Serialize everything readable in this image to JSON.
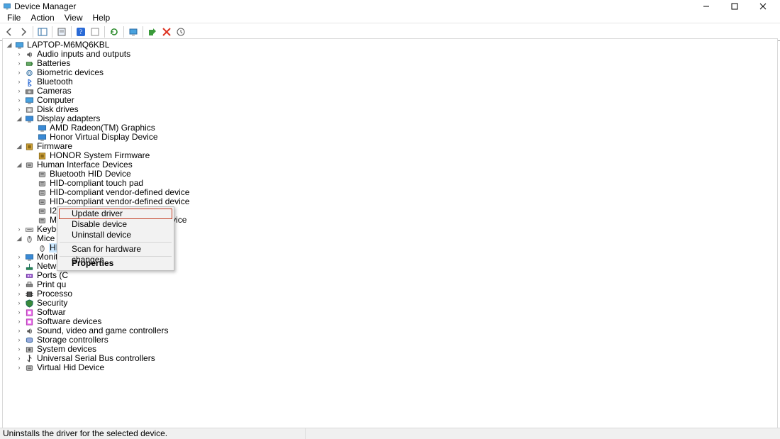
{
  "window": {
    "title": "Device Manager"
  },
  "menubar": [
    "File",
    "Action",
    "View",
    "Help"
  ],
  "statusbar": "Uninstalls the driver for the selected device.",
  "context_menu": {
    "items": [
      {
        "label": "Update driver",
        "highlighted": true
      },
      {
        "label": "Disable device"
      },
      {
        "label": "Uninstall device"
      },
      {
        "separator": true
      },
      {
        "label": "Scan for hardware changes"
      },
      {
        "separator": true
      },
      {
        "label": "Properties",
        "bold": true
      }
    ]
  },
  "tree": {
    "root": {
      "label": "LAPTOP-M6MQ6KBL",
      "icon": "computer-icon",
      "expanded": true
    },
    "categories": [
      {
        "label": "Audio inputs and outputs",
        "icon": "audio-icon",
        "state": "collapsed"
      },
      {
        "label": "Batteries",
        "icon": "battery-icon",
        "state": "collapsed"
      },
      {
        "label": "Biometric devices",
        "icon": "biometric-icon",
        "state": "collapsed"
      },
      {
        "label": "Bluetooth",
        "icon": "bluetooth-icon",
        "state": "collapsed"
      },
      {
        "label": "Cameras",
        "icon": "camera-icon",
        "state": "collapsed"
      },
      {
        "label": "Computer",
        "icon": "computer-icon",
        "state": "collapsed"
      },
      {
        "label": "Disk drives",
        "icon": "disk-icon",
        "state": "collapsed"
      },
      {
        "label": "Display adapters",
        "icon": "display-icon",
        "state": "expanded",
        "children": [
          {
            "label": "AMD Radeon(TM) Graphics",
            "icon": "display-icon"
          },
          {
            "label": "Honor Virtual Display Device",
            "icon": "display-icon"
          }
        ]
      },
      {
        "label": "Firmware",
        "icon": "firmware-icon",
        "state": "expanded",
        "children": [
          {
            "label": "HONOR System Firmware",
            "icon": "firmware-icon"
          }
        ]
      },
      {
        "label": "Human Interface Devices",
        "icon": "hid-icon",
        "state": "expanded",
        "children": [
          {
            "label": "Bluetooth HID Device",
            "icon": "hid-icon"
          },
          {
            "label": "HID-compliant touch pad",
            "icon": "hid-icon"
          },
          {
            "label": "HID-compliant vendor-defined device",
            "icon": "hid-icon"
          },
          {
            "label": "HID-compliant vendor-defined device",
            "icon": "hid-icon"
          },
          {
            "label": "I2C HID Device",
            "icon": "hid-icon"
          },
          {
            "label": "Microsoft Input Configuration Device",
            "icon": "hid-icon"
          }
        ]
      },
      {
        "label": "Keyboards",
        "icon": "keyboard-icon",
        "state": "collapsed"
      },
      {
        "label": "Mice and other pointing devices",
        "icon": "mouse-icon",
        "state": "expanded",
        "children": [
          {
            "label": "HID-",
            "icon": "mouse-icon",
            "selected": true
          }
        ]
      },
      {
        "label": "Monito",
        "icon": "display-icon",
        "state": "collapsed"
      },
      {
        "label": "Network",
        "icon": "network-icon",
        "state": "collapsed"
      },
      {
        "label": "Ports (C",
        "icon": "port-icon",
        "state": "collapsed"
      },
      {
        "label": "Print qu",
        "icon": "printer-icon",
        "state": "collapsed"
      },
      {
        "label": "Processo",
        "icon": "cpu-icon",
        "state": "collapsed"
      },
      {
        "label": "Security",
        "icon": "security-icon",
        "state": "collapsed"
      },
      {
        "label": "Softwar",
        "icon": "software-icon",
        "state": "collapsed"
      },
      {
        "label": "Software devices",
        "icon": "software-icon",
        "state": "collapsed"
      },
      {
        "label": "Sound, video and game controllers",
        "icon": "audio-icon",
        "state": "collapsed"
      },
      {
        "label": "Storage controllers",
        "icon": "storage-icon",
        "state": "collapsed"
      },
      {
        "label": "System devices",
        "icon": "system-icon",
        "state": "collapsed"
      },
      {
        "label": "Universal Serial Bus controllers",
        "icon": "usb-icon",
        "state": "collapsed"
      },
      {
        "label": "Virtual Hid Device",
        "icon": "hid-icon",
        "state": "collapsed"
      }
    ]
  }
}
